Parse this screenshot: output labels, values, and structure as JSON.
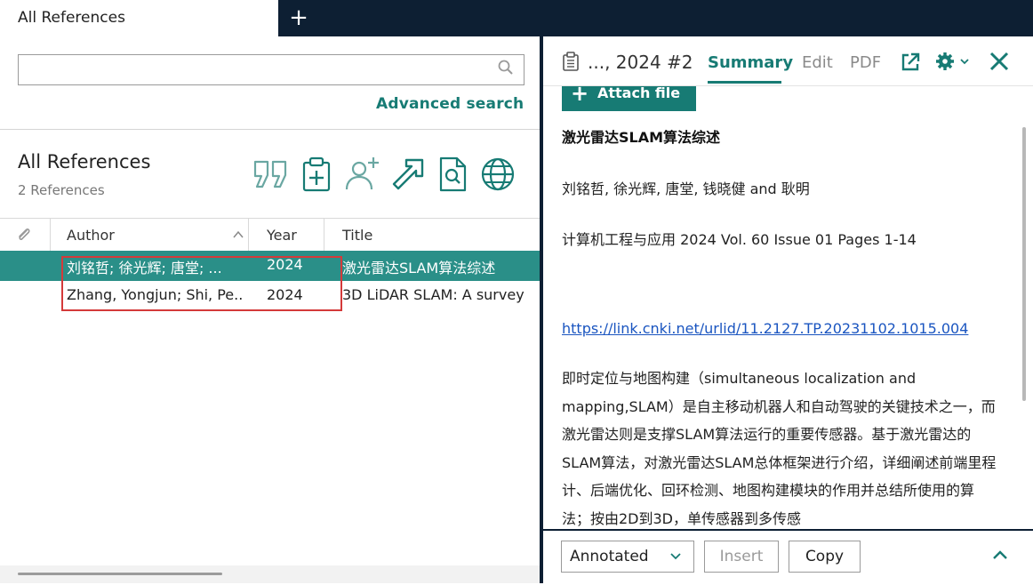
{
  "tabs": {
    "active_label": "All References",
    "add_label": "+"
  },
  "search": {
    "placeholder": "",
    "advanced_label": "Advanced search"
  },
  "library": {
    "title": "All References",
    "count": "2 References"
  },
  "toolbar_icons": [
    "quote-icon",
    "clipboard-plus-icon",
    "add-user-icon",
    "share-arrow-icon",
    "find-pdf-icon",
    "globe-icon"
  ],
  "table": {
    "columns": [
      "Author",
      "Year",
      "Title"
    ],
    "rows": [
      {
        "author": "刘铭哲; 徐光辉; 唐堂; ...",
        "year": "2024",
        "title": "激光雷达SLAM算法综述",
        "selected": true
      },
      {
        "author": "Zhang, Yongjun; Shi, Pe...",
        "year": "2024",
        "title": "3D LiDAR SLAM: A survey",
        "selected": false
      }
    ]
  },
  "detail": {
    "ref_label": "..., 2024 #2",
    "tabs": {
      "summary": "Summary",
      "edit": "Edit",
      "pdf": "PDF"
    },
    "attach_label": "Attach file",
    "title": "激光雷达SLAM算法综述",
    "authors": "刘铭哲, 徐光辉, 唐堂, 钱晓健 and 耿明",
    "journal": "计算机工程与应用 2024 Vol. 60 Issue 01 Pages 1-14",
    "link": "https://link.cnki.net/urlid/11.2127.TP.20231102.1015.004",
    "abstract": "即时定位与地图构建（simultaneous localization and mapping,SLAM）是自主移动机器人和自动驾驶的关键技术之一，而激光雷达则是支撑SLAM算法运行的重要传感器。基于激光雷达的SLAM算法，对激光雷达SLAM总体框架进行介绍，详细阐述前端里程计、后端优化、回环检测、地图构建模块的作用并总结所使用的算法；按由2D到3D，单传感器到多传感"
  },
  "bottom": {
    "style_value": "Annotated",
    "insert_label": "Insert",
    "copy_label": "Copy"
  },
  "colors": {
    "accent": "#177b74",
    "selected_row": "#2a8f88",
    "navy": "#0d1f33",
    "highlight": "#d43a3a"
  }
}
